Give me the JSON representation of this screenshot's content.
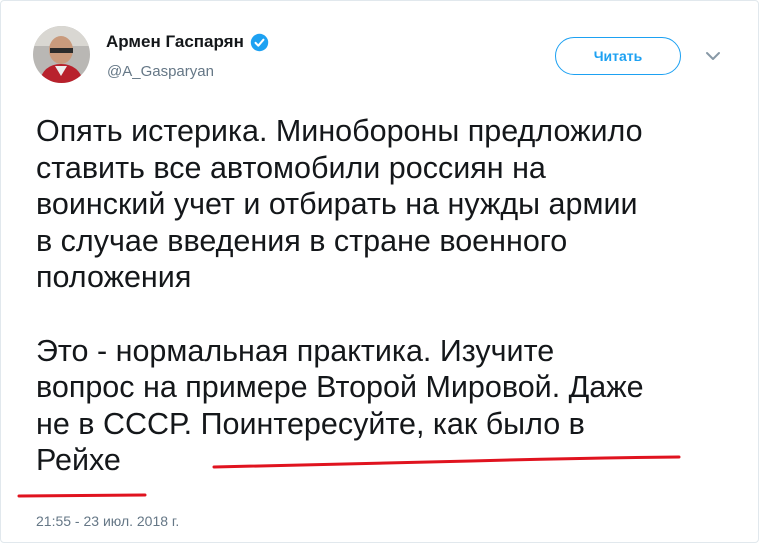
{
  "author": {
    "display_name": "Армен Гаспарян",
    "handle": "@A_Gasparyan"
  },
  "follow_button": {
    "label": "Читать"
  },
  "tweet": {
    "text": "Опять истерика. Минобороны предложило\nставить все автомобили россиян на\nвоинский учет и отбирать на нужды армии\nв случае введения в стране военного\nположения\n\nЭто - нормальная практика. Изучите\nвопрос на примере Второй Мировой. Даже\nне в СССР. Поинтересуйте, как было в\nРейхе",
    "timestamp": "21:55 - 23 июл. 2018 г."
  },
  "colors": {
    "accent": "#1da1f2",
    "underline": "#e0131f",
    "text": "#14171a",
    "secondary": "#657786"
  },
  "icons": [
    "verified-badge-icon",
    "chevron-down-icon"
  ]
}
